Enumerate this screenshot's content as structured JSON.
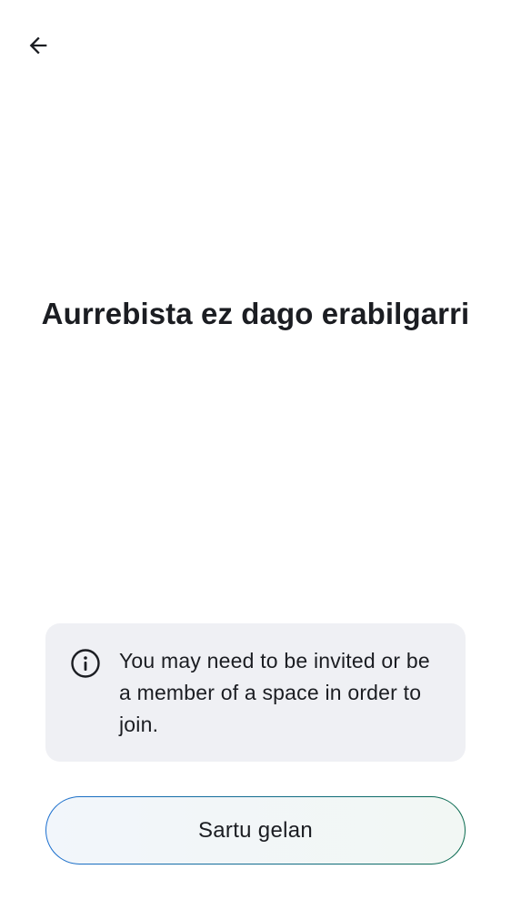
{
  "header": {
    "back_icon": "arrow-left-icon"
  },
  "main": {
    "title": "Aurrebista ez dago erabilgarri"
  },
  "notice": {
    "icon": "info-icon",
    "text": "You may need to be invited or be a member of a space in order to join."
  },
  "actions": {
    "join_label": "Sartu gelan"
  },
  "colors": {
    "text": "#1b1d22",
    "notice_bg": "#eff0f4",
    "button_border_start": "#1b6fd0",
    "button_border_end": "#0b6b4f"
  }
}
